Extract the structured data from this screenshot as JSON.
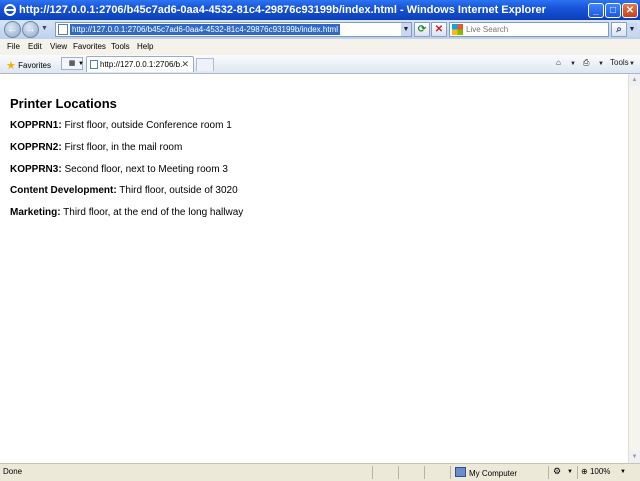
{
  "window": {
    "title": "http://127.0.0.1:2706/b45c7ad6-0aa4-4532-81c4-29876c93199b/index.html - Windows Internet Explorer"
  },
  "address": {
    "url": "http://127.0.0.1:2706/b45c7ad6-0aa4-4532-81c4-29876c93199b/index.html"
  },
  "search": {
    "placeholder": "Live Search"
  },
  "menu": {
    "items": [
      "File",
      "Edit",
      "View",
      "Favorites",
      "Tools",
      "Help"
    ]
  },
  "favorites_bar": {
    "favorites_label": "Favorites",
    "tab_label": "http://127.0.0.1:2706/b...",
    "tools_label": "Tools"
  },
  "page": {
    "heading": "Printer Locations",
    "locations": [
      {
        "name": "KOPPRN1:",
        "desc": " First floor, outside Conference room 1"
      },
      {
        "name": "KOPPRN2:",
        "desc": " First floor, in the mail room"
      },
      {
        "name": "KOPPRN3:",
        "desc": " Second floor, next to Meeting room 3"
      },
      {
        "name": "Content Development:",
        "desc": " Third floor, outside of 3020"
      },
      {
        "name": "Marketing:",
        "desc": " Third floor, at the end of the long hallway"
      }
    ]
  },
  "status": {
    "text": "Done",
    "zone": "My Computer",
    "zoom": "100%"
  },
  "icons": {
    "ie": "ie-logo-icon",
    "back": "back-arrow-icon",
    "forward": "forward-arrow-icon",
    "refresh": "refresh-icon",
    "stop": "stop-icon",
    "search": "magnifier-icon",
    "favorites": "star-icon",
    "home": "home-icon",
    "print": "printer-icon"
  },
  "colors": {
    "titlebar": "#0a3fb8",
    "url_highlight": "#316ac5",
    "page_background": "#ffffff"
  }
}
